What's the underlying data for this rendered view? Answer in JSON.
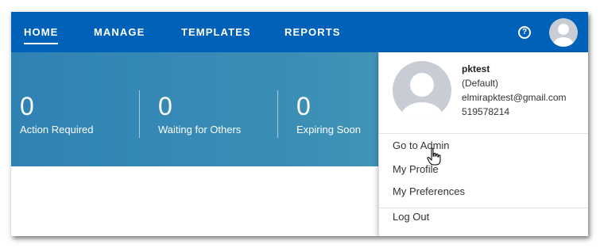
{
  "nav": {
    "items": [
      {
        "label": "HOME",
        "active": true
      },
      {
        "label": "MANAGE",
        "active": false
      },
      {
        "label": "TEMPLATES",
        "active": false
      },
      {
        "label": "REPORTS",
        "active": false
      }
    ],
    "help_icon": "question-circle-icon",
    "avatar_icon": "user-avatar-icon",
    "bar_color": "#0061b8"
  },
  "stats": [
    {
      "value": "0",
      "label": "Action Required"
    },
    {
      "value": "0",
      "label": "Waiting for Others"
    },
    {
      "value": "0",
      "label": "Expiring Soon"
    }
  ],
  "profile_menu": {
    "name": "pktest",
    "role": "(Default)",
    "email": "elmirapktest@gmail.com",
    "account_id": "519578214",
    "items": [
      "Go to Admin",
      "My Profile",
      "My Preferences",
      "Log Out"
    ]
  }
}
